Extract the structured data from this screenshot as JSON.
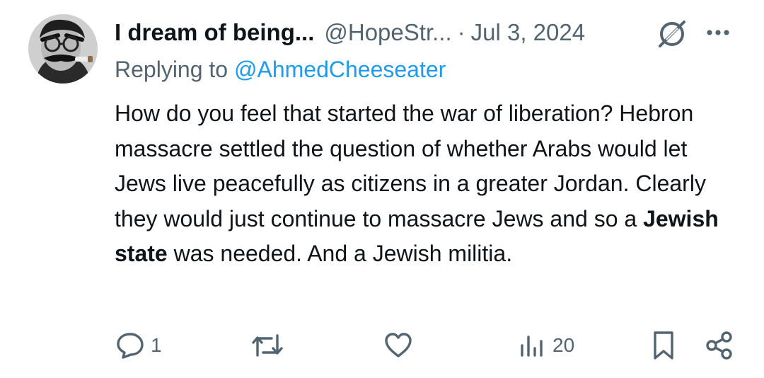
{
  "tweet": {
    "display_name": "I dream of being...",
    "handle": "@HopeStr...",
    "separator": "·",
    "date": "Jul 3, 2024",
    "replying_to_prefix": "Replying to",
    "replying_to_handle": "@AhmedCheeseater",
    "text_before_bold": "How do you feel that started the war of liberation? Hebron massacre settled the question of whether Arabs would let Jews live peacefully as citizens in a greater Jordan. Clearly they would just continue to massacre Jews and so a ",
    "text_bold": "Jewish state",
    "text_after_bold": " was needed. And a Jewish militia."
  },
  "actions": {
    "replies": "1",
    "retweets": "",
    "likes": "",
    "views": "20"
  },
  "icons": [
    "avatar",
    "grok-icon",
    "more-icon",
    "reply-icon",
    "retweet-icon",
    "like-icon",
    "views-icon",
    "bookmark-icon",
    "share-icon"
  ],
  "colors": {
    "text": "#0f1419",
    "secondary": "#536471",
    "link": "#1d9bf0"
  }
}
